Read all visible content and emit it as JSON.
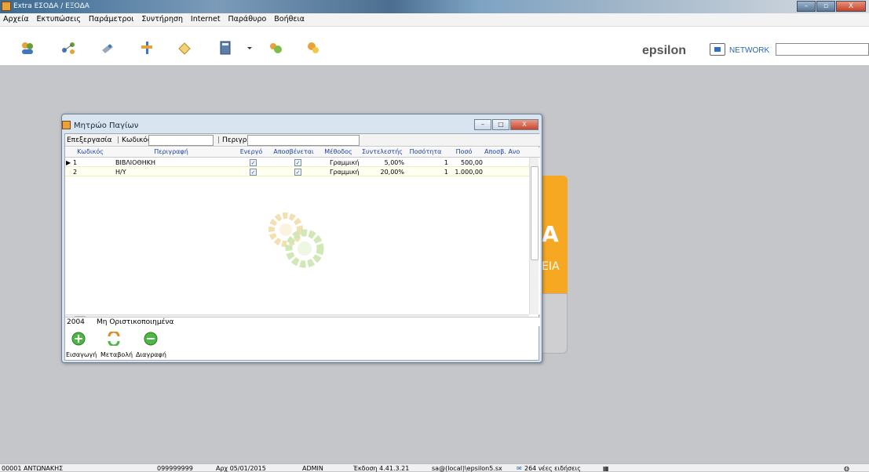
{
  "app": {
    "title": "Extra ΕΣΟΔΑ / ΕΞΟΔΑ"
  },
  "window_buttons": {
    "minimize": "–",
    "maximize": "▫",
    "close": "X"
  },
  "menu": [
    "Αρχεία",
    "Εκτυπώσεις",
    "Παράμετροι",
    "Συντήρηση",
    "Internet",
    "Παράθυρο",
    "Βοήθεια"
  ],
  "toolbar": {
    "icons": [
      "users-icon",
      "network-icon",
      "shuttle-icon",
      "pin-icon",
      "eraser-icon",
      "calculator-icon",
      "dropdown-arrow-icon",
      "gears-icon",
      "gear-yellow-icon"
    ],
    "brand": "epsilon",
    "network": "NETWORK",
    "search_value": ""
  },
  "background": {
    "big_letter": "A",
    "text": "ΕΙΑ"
  },
  "dialog": {
    "title": "Μητρώο Παγίων",
    "buttons": {
      "minimize": "–",
      "maximize": "□",
      "close": "X"
    },
    "filter": {
      "menu": "Επεξεργασία",
      "code_label": "Κωδικός",
      "code_value": "",
      "desc_label": "Περιγραφή",
      "desc_value": ""
    },
    "columns": [
      "Κωδικός",
      "Περιγραφή",
      "Ενεργό",
      "Αποσβένεται",
      "Μέθοδος",
      "Συντελεστής",
      "Ποσότητα",
      "Ποσό",
      "Αποσβ. Ανο"
    ],
    "rows": [
      {
        "code": "1",
        "desc": "ΒΙΒΛΙΟΘΗΚΗ",
        "active": "✓",
        "depr": "✓",
        "method": "Γραμμική",
        "rate": "5,00%",
        "qty": "1",
        "amount": "500,00"
      },
      {
        "code": "2",
        "desc": "Η/Υ",
        "active": "✓",
        "depr": "✓",
        "method": "Γραμμική",
        "rate": "20,00%",
        "qty": "1",
        "amount": "1.000,00"
      }
    ],
    "row_indicator": "▶",
    "status": {
      "year": "2004",
      "state": "Μη Οριστικοποιημένα"
    },
    "actions": {
      "insert": "Εισαγωγή",
      "change": "Μεταβολή",
      "delete": "Διαγραφή"
    }
  },
  "statusbar": {
    "company": "00001 ΑΝΤΩΝΑΚΗΣ",
    "afm": "099999999",
    "date": "Αρχ 05/01/2015",
    "user": "ADMIN",
    "version": "Έκδοση 4.41.3.21",
    "db": "sa@(local)\\epsilon5.sx",
    "mail": "264 νέες ειδήσεις"
  },
  "colors": {
    "orange": "#f7a823",
    "header_blue": "#1d43a3",
    "window_frame": "#d8e4f0"
  }
}
